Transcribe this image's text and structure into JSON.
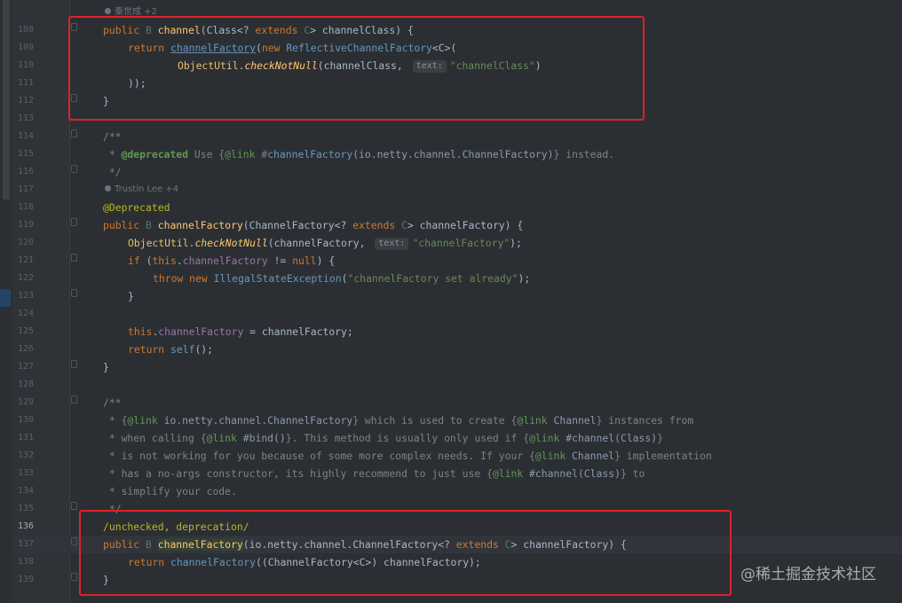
{
  "editor": {
    "authors": [
      {
        "name": "秦世成 +2"
      },
      {
        "name": "Trustin Lee +4"
      }
    ],
    "line_numbers": [
      "108",
      "109",
      "110",
      "111",
      "112",
      "113",
      "114",
      "115",
      "116",
      "117",
      "118",
      "119",
      "120",
      "121",
      "122",
      "123",
      "124",
      "125",
      "126",
      "127",
      "128",
      "129",
      "130",
      "131",
      "132",
      "133",
      "134",
      "135",
      "136",
      "137",
      "138",
      "139"
    ],
    "current_line": "136",
    "inlay_hint": "text:",
    "lines": {
      "l108": {
        "a": "public ",
        "b": "B ",
        "c": "channel",
        "d": "(",
        "e": "Class",
        "f": "<? ",
        "g": "extends ",
        "h": "C",
        "i": "> channelClass) {"
      },
      "l109": {
        "a": "return ",
        "b": "channelFactory",
        "c": "(",
        "d": "new ",
        "e": "ReflectiveChannelFactory",
        "f": "<C>("
      },
      "l110": {
        "a": "ObjectUtil",
        "b": ".",
        "c": "checkNotNull",
        "d": "(channelClass, ",
        "e": "\"channelClass\"",
        "f": ")"
      },
      "l111": {
        "a": "));"
      },
      "l112": {
        "a": "}"
      },
      "l114": {
        "a": "/**"
      },
      "l115": {
        "a": " * ",
        "b": "@deprecated",
        "c": " Use {",
        "d": "@link",
        "e": " #",
        "f": "channelFactory",
        "g": "(io.netty.channel.ChannelFactory)",
        "h": "} instead."
      },
      "l116": {
        "a": " */"
      },
      "l117": {
        "a": "@Deprecated"
      },
      "l118": {
        "a": "public ",
        "b": "B ",
        "c": "channelFactory",
        "d": "(ChannelFactory<? ",
        "e": "extends ",
        "f": "C",
        "g": "> channelFactory) {"
      },
      "l119": {
        "a": "ObjectUtil",
        "b": ".",
        "c": "checkNotNull",
        "d": "(channelFactory, ",
        "e": "\"channelFactory\"",
        "f": ");"
      },
      "l120": {
        "a": "if ",
        "b": "(",
        "c": "this",
        "d": ".",
        "e": "channelFactory",
        "f": " != ",
        "g": "null",
        "h": ") {"
      },
      "l121": {
        "a": "throw ",
        "b": "new ",
        "c": "IllegalStateException",
        "d": "(",
        "e": "\"channelFactory set already\"",
        "f": ");"
      },
      "l122": {
        "a": "}"
      },
      "l124": {
        "a": "this",
        "b": ".",
        "c": "channelFactory",
        "d": " = channelFactory;"
      },
      "l125": {
        "a": "return ",
        "b": "self",
        "c": "();"
      },
      "l126": {
        "a": "}"
      },
      "l128": {
        "a": "/**"
      },
      "l129": {
        "a": " * {",
        "b": "@link",
        "c": " io.netty.channel.ChannelFactory",
        "d": "} which is used to create {",
        "e": "@link",
        "f": " Channel",
        "g": "} instances from"
      },
      "l130": {
        "a": " * when calling {",
        "b": "@link",
        "c": " #bind",
        "d": "()",
        "e": "}. This method is usually only used if {",
        "f": "@link",
        "g": " #channel",
        "h": "(Class)",
        "i": "}"
      },
      "l131": {
        "a": " * is not working for you because of some more complex needs. If your {",
        "b": "@link",
        "c": " Channel",
        "d": "} implementation"
      },
      "l132": {
        "a": " * has a no-args constructor, its highly recommend to just use {",
        "b": "@link",
        "c": " #channel",
        "d": "(Class)",
        "e": "} to"
      },
      "l133": {
        "a": " * simplify your code."
      },
      "l134": {
        "a": " */"
      },
      "l135": {
        "a": "/unchecked, deprecation/"
      },
      "l136": {
        "a": "public ",
        "b": "B ",
        "c": "channelFactory",
        "d": "(io.netty.channel.ChannelFactory<? ",
        "e": "extends ",
        "f": "C",
        "g": "> channelFactory) {"
      },
      "l137": {
        "a": "return ",
        "b": "channelFactory",
        "c": "((ChannelFactory<C>) channelFactory);"
      },
      "l138": {
        "a": "}"
      }
    }
  },
  "watermark": "@稀土掘金技术社区",
  "colors": {
    "highlight_box": "#e0202a",
    "background": "#2b2f33",
    "keyword": "#cc7832",
    "field": "#9876aa",
    "string": "#6a8759",
    "comment": "#808080"
  }
}
